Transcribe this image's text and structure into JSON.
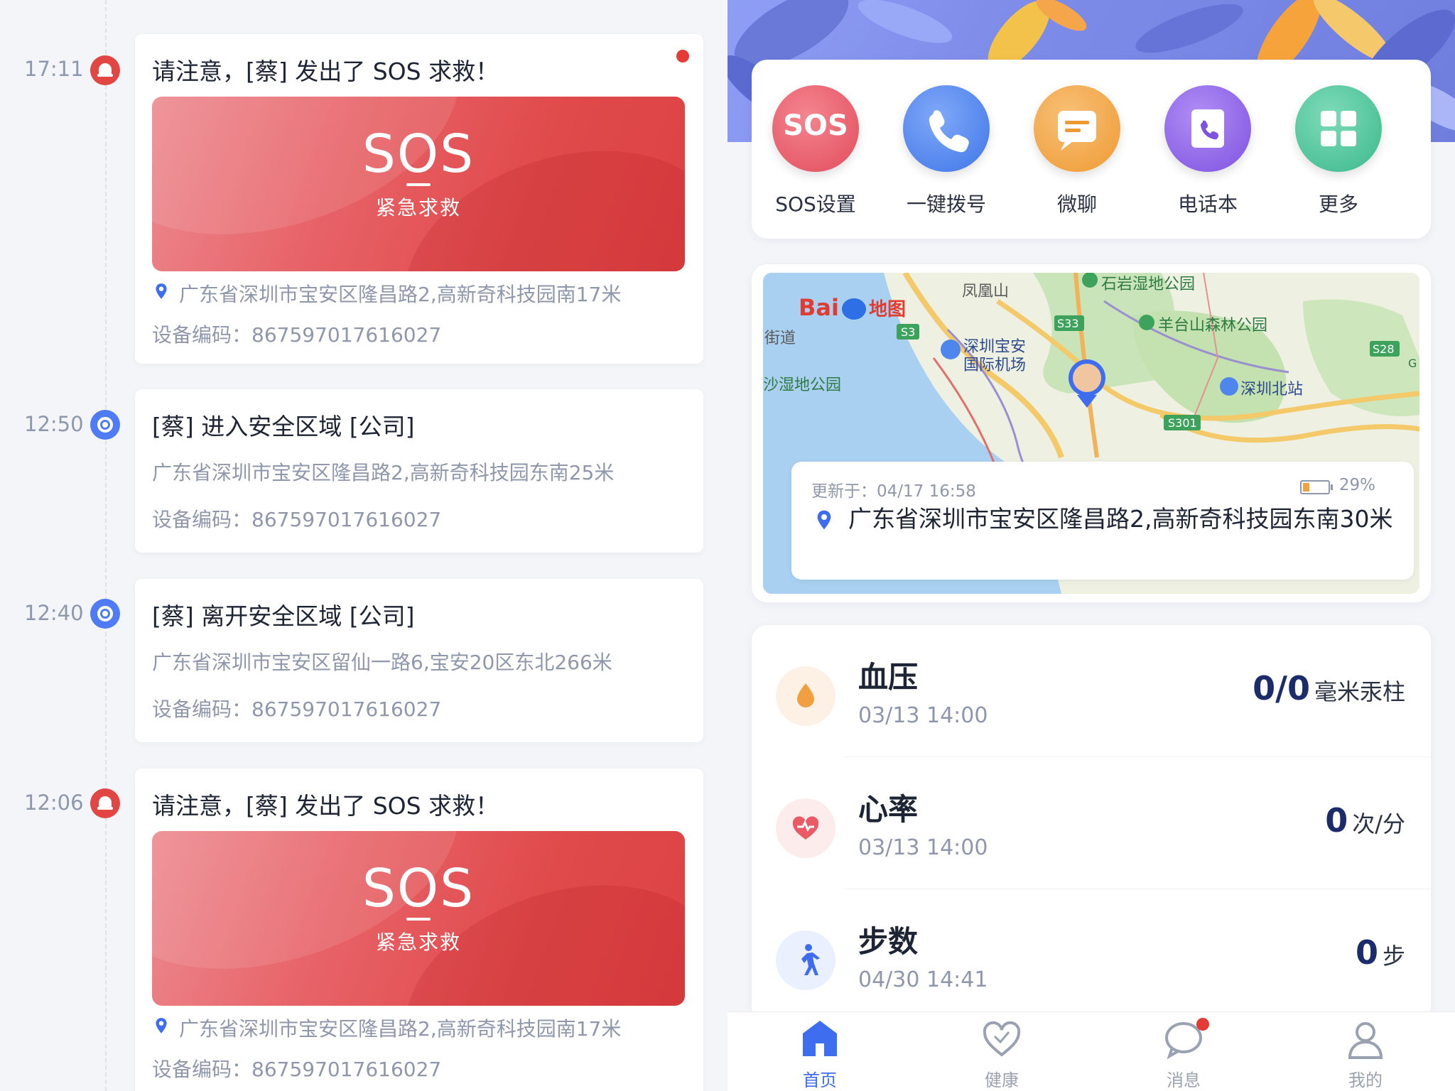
{
  "left_panel": {
    "events": [
      {
        "time": "17:11",
        "type": "sos",
        "title": "请注意，[蔡] 发出了 SOS 求救！",
        "unread": true,
        "banner_title": "SOS",
        "banner_subtitle": "紧急求救",
        "address": "广东省深圳市宝安区隆昌路2,高新奇科技园南17米",
        "device_code": "设备编码：867597017616027"
      },
      {
        "time": "12:50",
        "type": "location",
        "title": "[蔡] 进入安全区域 [公司]",
        "address": "广东省深圳市宝安区隆昌路2,高新奇科技园东南25米",
        "device_code": "设备编码：867597017616027"
      },
      {
        "time": "12:40",
        "type": "location",
        "title": "[蔡] 离开安全区域 [公司]",
        "address": "广东省深圳市宝安区留仙一路6,宝安20区东北266米",
        "device_code": "设备编码：867597017616027"
      },
      {
        "time": "12:06",
        "type": "sos",
        "title": "请注意，[蔡] 发出了 SOS 求救！",
        "banner_title": "SOS",
        "banner_subtitle": "紧急求救",
        "address": "广东省深圳市宝安区隆昌路2,高新奇科技园南17米",
        "device_code": "设备编码：867597017616027"
      }
    ]
  },
  "right_panel": {
    "quick_actions": [
      {
        "label": "SOS设置",
        "icon": "sos-icon",
        "icon_text": "SOS",
        "color": "#e9596b"
      },
      {
        "label": "一键拨号",
        "icon": "phone-icon",
        "color": "#4f86ee"
      },
      {
        "label": "微聊",
        "icon": "chat-icon",
        "color": "#f1a340"
      },
      {
        "label": "电话本",
        "icon": "phonebook-icon",
        "color": "#8c62e6"
      },
      {
        "label": "更多",
        "icon": "grid-icon",
        "color": "#48c39a"
      }
    ],
    "map": {
      "brand": "Bai",
      "brand_suffix": "地图",
      "labels": {
        "fenghuangshan": "凤凰山",
        "shiyan_park": "石岩湿地公园",
        "jiedao": "街道",
        "airport_1": "深圳宝安",
        "airport_2": "国际机场",
        "yangtaishan": "羊台山森林公园",
        "shawetland": "沙湿地公园",
        "shenzhen_north": "深圳北站",
        "s33": "S33",
        "s3": "S3",
        "s28": "S28",
        "s301": "S301",
        "g": "G"
      },
      "updated": "更新于：04/17 16:58",
      "battery": "29%",
      "battery_level": 0.29,
      "address": "广东省深圳市宝安区隆昌路2,高新奇科技园东南30米"
    },
    "health": [
      {
        "name": "血压",
        "time": "03/13 14:00",
        "value": "0/0",
        "unit": "毫米汞柱",
        "icon": "blood-drop-icon"
      },
      {
        "name": "心率",
        "time": "03/13 14:00",
        "value": "0",
        "unit": "次/分",
        "icon": "heart-rate-icon"
      },
      {
        "name": "步数",
        "time": "04/30 14:41",
        "value": "0",
        "unit": "步",
        "icon": "walking-icon"
      }
    ],
    "tabs": [
      {
        "label": "首页",
        "icon": "home-icon",
        "active": true
      },
      {
        "label": "健康",
        "icon": "heart-icon"
      },
      {
        "label": "消息",
        "icon": "message-icon",
        "badge": true
      },
      {
        "label": "我的",
        "icon": "user-icon"
      }
    ],
    "colors": {
      "accent": "#3f6df0",
      "sos_red": "#e04a4b",
      "value_navy": "#1c2c6b"
    }
  }
}
